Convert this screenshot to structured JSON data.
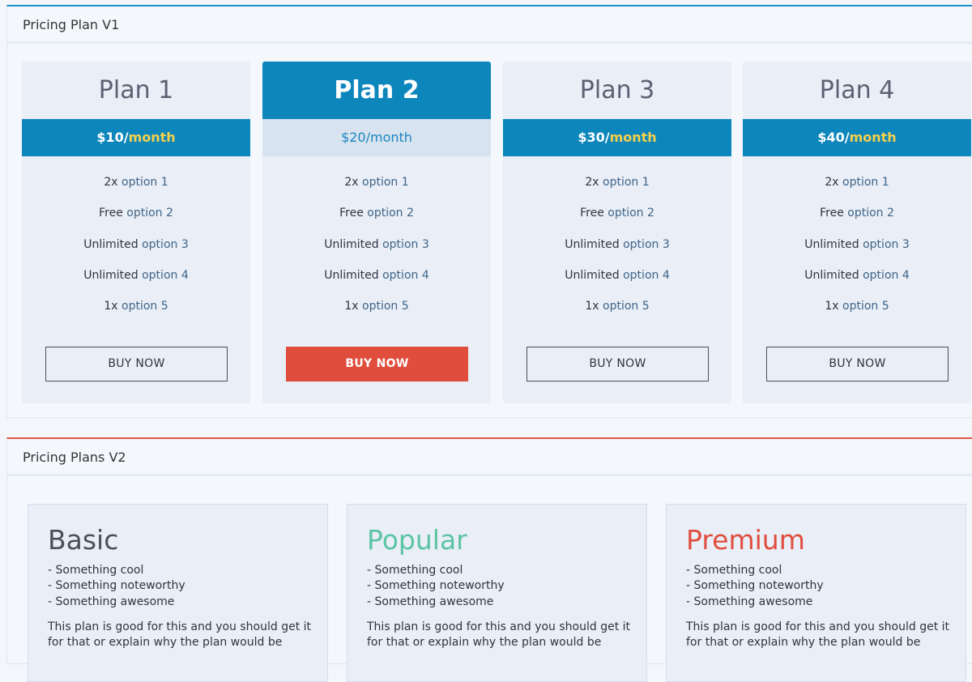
{
  "v1": {
    "title": "Pricing Plan V1",
    "plans": [
      {
        "name": "Plan 1",
        "price": "$10/",
        "period": "month",
        "features": [
          {
            "pre": "2x ",
            "opt": "option 1"
          },
          {
            "pre": "Free ",
            "opt": "option 2"
          },
          {
            "pre": "Unlimited ",
            "opt": "option 3"
          },
          {
            "pre": "Unlimited ",
            "opt": "option 4"
          },
          {
            "pre": "1x ",
            "opt": "option 5"
          }
        ],
        "button": "BUY NOW"
      },
      {
        "name": "Plan 2",
        "price": "$20/",
        "period": "month",
        "features": [
          {
            "pre": "2x ",
            "opt": "option 1"
          },
          {
            "pre": "Free ",
            "opt": "option 2"
          },
          {
            "pre": "Unlimited ",
            "opt": "option 3"
          },
          {
            "pre": "Unlimited ",
            "opt": "option 4"
          },
          {
            "pre": "1x ",
            "opt": "option 5"
          }
        ],
        "button": "BUY NOW"
      },
      {
        "name": "Plan 3",
        "price": "$30/",
        "period": "month",
        "features": [
          {
            "pre": "2x ",
            "opt": "option 1"
          },
          {
            "pre": "Free ",
            "opt": "option 2"
          },
          {
            "pre": "Unlimited ",
            "opt": "option 3"
          },
          {
            "pre": "Unlimited ",
            "opt": "option 4"
          },
          {
            "pre": "1x ",
            "opt": "option 5"
          }
        ],
        "button": "BUY NOW"
      },
      {
        "name": "Plan 4",
        "price": "$40/",
        "period": "month",
        "features": [
          {
            "pre": "2x ",
            "opt": "option 1"
          },
          {
            "pre": "Free ",
            "opt": "option 2"
          },
          {
            "pre": "Unlimited ",
            "opt": "option 3"
          },
          {
            "pre": "Unlimited ",
            "opt": "option 4"
          },
          {
            "pre": "1x ",
            "opt": "option 5"
          }
        ],
        "button": "BUY NOW"
      }
    ]
  },
  "v2": {
    "title": "Pricing Plans V2",
    "plans": [
      {
        "name": "Basic",
        "bullets": [
          "- Something cool",
          "- Something noteworthy",
          "- Something awesome"
        ],
        "description": "This plan is good for this and you should get it for that or explain why the plan would be"
      },
      {
        "name": "Popular",
        "bullets": [
          "- Something cool",
          "- Something noteworthy",
          "- Something awesome"
        ],
        "description": "This plan is good for this and you should get it for that or explain why the plan would be"
      },
      {
        "name": "Premium",
        "bullets": [
          "- Something cool",
          "- Something noteworthy",
          "- Something awesome"
        ],
        "description": "This plan is good for this and you should get it for that or explain why the plan would be"
      }
    ]
  },
  "colors": {
    "accent_blue": "#0d86bc",
    "accent_red": "#e14d3d",
    "accent_green": "#5cc4a2",
    "price_period": "#f5d04a"
  }
}
